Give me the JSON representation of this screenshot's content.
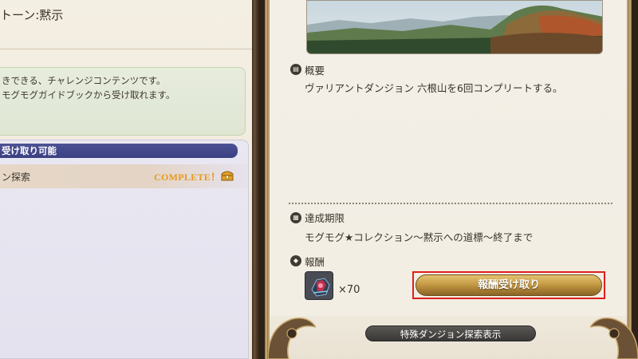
{
  "left": {
    "title": "トーン:黙示",
    "description_lines": [
      "きできる、チャレンジコンテンツです。",
      "モグモグガイドブックから受け取れます。"
    ],
    "list_header": "受け取り可能",
    "list_rows": [
      {
        "label": "ン探索",
        "status": "COMPLETE！",
        "icon": "treasure-chest-icon"
      }
    ]
  },
  "right": {
    "overview_title": "概要",
    "overview_body": "ヴァリアントダンジョン 六根山を6回コンプリートする。",
    "deadline_title": "達成期限",
    "deadline_body": "モグモグ★コレクション〜黙示への道標〜終了まで",
    "reward_title": "報酬",
    "reward_qty": "×70",
    "reward_icon": "tomestone-item-icon",
    "claim_button": "報酬受け取り",
    "explore_button": "特殊ダンジョン探索表示"
  },
  "colors": {
    "accent_gold": "#c69b45",
    "header_blue": "#4c5294",
    "complete_orange": "#e69a1e",
    "highlight_red": "#e0201c"
  }
}
